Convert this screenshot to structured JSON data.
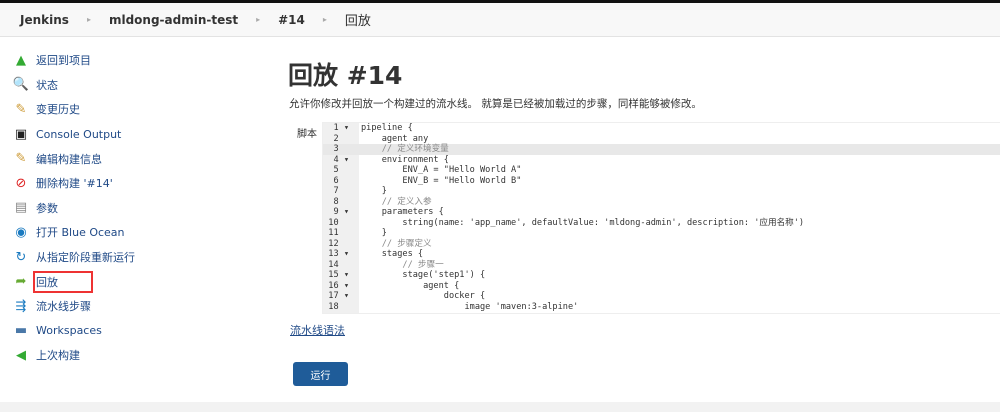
{
  "breadcrumbs": [
    "Jenkins",
    "mldong-admin-test",
    "#14",
    "回放"
  ],
  "sidebar": {
    "items": [
      {
        "label": "返回到项目",
        "icon": "arrow-up-icon"
      },
      {
        "label": "状态",
        "icon": "search-icon"
      },
      {
        "label": "变更历史",
        "icon": "notepad-icon"
      },
      {
        "label": "Console Output",
        "icon": "terminal-icon"
      },
      {
        "label": "编辑构建信息",
        "icon": "notepad-icon"
      },
      {
        "label": "删除构建 '#14'",
        "icon": "no-entry-icon"
      },
      {
        "label": "参数",
        "icon": "document-icon"
      },
      {
        "label": "打开 Blue Ocean",
        "icon": "blue-ocean-icon"
      },
      {
        "label": "从指定阶段重新运行",
        "icon": "restart-icon"
      },
      {
        "label": "回放",
        "icon": "replay-icon"
      },
      {
        "label": "流水线步骤",
        "icon": "steps-icon"
      },
      {
        "label": "Workspaces",
        "icon": "folder-icon"
      },
      {
        "label": "上次构建",
        "icon": "arrow-left-icon"
      }
    ]
  },
  "main": {
    "title": "回放 #14",
    "description": "允许你修改并回放一个构建过的流水线。 就算是已经被加载过的步骤，同样能够被修改。",
    "script_label": "脚本",
    "syntax_link": "流水线语法",
    "run_button": "运行"
  },
  "code": [
    "pipeline {",
    "    agent any",
    "    // 定义环境变量",
    "    environment {",
    "        ENV_A = \"Hello World A\"",
    "        ENV_B = \"Hello World B\"",
    "    }",
    "    // 定义入参",
    "    parameters {",
    "        string(name: 'app_name', defaultValue: 'mldong-admin', description: '应用名称')",
    "    }",
    "    // 步骤定义",
    "    stages {",
    "        // 步骤一",
    "        stage('step1') {",
    "            agent {",
    "                docker {",
    "                    image 'maven:3-alpine'"
  ]
}
